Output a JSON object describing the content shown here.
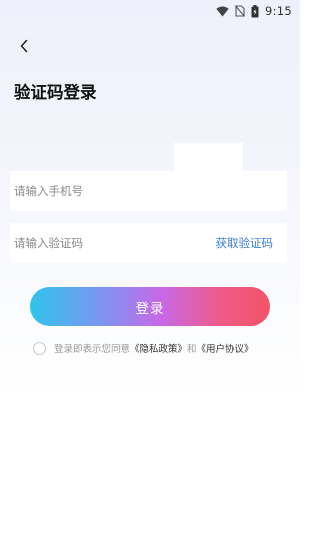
{
  "status_bar": {
    "time": "9:15",
    "icons": [
      "wifi-icon",
      "no-sim-icon",
      "battery-icon"
    ]
  },
  "header": {
    "back_icon": "chevron-left-icon",
    "title": "验证码登录"
  },
  "form": {
    "phone": {
      "placeholder": "请输入手机号",
      "value": ""
    },
    "code": {
      "placeholder": "请输入验证码",
      "value": ""
    },
    "get_code_label": "获取验证码",
    "login_label": "登录"
  },
  "agreement": {
    "checked": false,
    "prefix": "登录即表示您同意",
    "privacy_link": "《隐私政策》",
    "and": "和",
    "user_agreement_link": "《用户协议》"
  },
  "colors": {
    "link": "#3b7ed9",
    "gradient_start": "#2fc4ec",
    "gradient_end": "#f25367"
  }
}
